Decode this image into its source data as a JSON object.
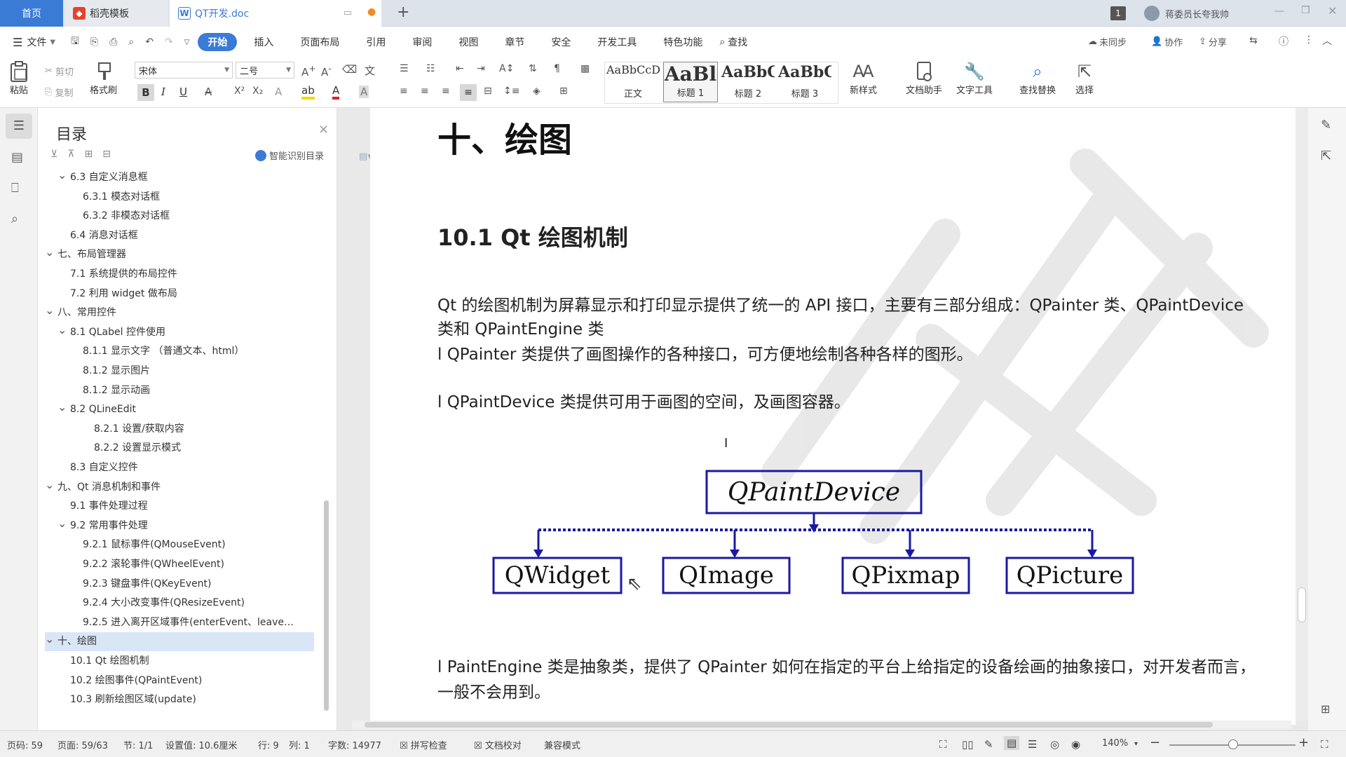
{
  "tabs": {
    "home": "首页",
    "template": "稻壳模板",
    "doc": "QT开发.doc",
    "add": "+"
  },
  "titlebar": {
    "badge": "1",
    "user": "蒋委员长夸我帅"
  },
  "menu": {
    "file": "文件",
    "items": [
      "开始",
      "插入",
      "页面布局",
      "引用",
      "审阅",
      "视图",
      "章节",
      "安全",
      "开发工具",
      "特色功能"
    ],
    "search": "查找",
    "sync": "未同步",
    "collab": "协作",
    "share": "分享"
  },
  "ribbon": {
    "paste": "粘贴",
    "cut": "剪切",
    "copy": "复制",
    "format_painter": "格式刷",
    "font_name": "宋体",
    "font_size": "二号",
    "styles": [
      {
        "preview": "AaBbCcDd",
        "name": "正文"
      },
      {
        "preview": "AaBl",
        "name": "标题 1"
      },
      {
        "preview": "AaBbC",
        "name": "标题 2"
      },
      {
        "preview": "AaBbC",
        "name": "标题 3"
      }
    ],
    "new_style": "新样式",
    "doc_helper": "文档助手",
    "text_tools": "文字工具",
    "find_replace": "查找替换",
    "select": "选择"
  },
  "toc": {
    "title": "目录",
    "smart": "智能识别目录",
    "items": [
      {
        "text": "6.3  自定义消息框",
        "level": 2,
        "caret": "v"
      },
      {
        "text": "6.3.1 模态对话框",
        "level": 3,
        "caret": ""
      },
      {
        "text": "6.3.2 非模态对话框",
        "level": 3,
        "caret": ""
      },
      {
        "text": "6.4  消息对话框",
        "level": 2,
        "caret": ""
      },
      {
        "text": "七、布局管理器",
        "level": 1,
        "caret": "v"
      },
      {
        "text": "7.1  系统提供的布局控件",
        "level": 2,
        "caret": ""
      },
      {
        "text": "7.2  利用 widget 做布局",
        "level": 2,
        "caret": ""
      },
      {
        "text": "八、常用控件",
        "level": 1,
        "caret": "v"
      },
      {
        "text": "8.1 QLabel 控件使用",
        "level": 2,
        "caret": "v"
      },
      {
        "text": "8.1.1 显示文字  （普通文本、html）",
        "level": 3,
        "caret": ""
      },
      {
        "text": "8.1.2 显示图片",
        "level": 3,
        "caret": ""
      },
      {
        "text": "8.1.2 显示动画",
        "level": 3,
        "caret": ""
      },
      {
        "text": "8.2 QLineEdit",
        "level": 2,
        "caret": "v"
      },
      {
        "text": "8.2.1 设置/获取内容",
        "level": 4,
        "caret": ""
      },
      {
        "text": "8.2.2 设置显示模式",
        "level": 4,
        "caret": ""
      },
      {
        "text": "8.3  自定义控件",
        "level": 2,
        "caret": ""
      },
      {
        "text": "九、Qt 消息机制和事件",
        "level": 1,
        "caret": "v"
      },
      {
        "text": "9.1  事件处理过程",
        "level": 2,
        "caret": ""
      },
      {
        "text": "9.2  常用事件处理",
        "level": 2,
        "caret": "v"
      },
      {
        "text": "9.2.1  鼠标事件(QMouseEvent)",
        "level": 3,
        "caret": ""
      },
      {
        "text": "9.2.2  滚轮事件(QWheelEvent)",
        "level": 3,
        "caret": ""
      },
      {
        "text": "9.2.3  键盘事件(QKeyEvent)",
        "level": 3,
        "caret": ""
      },
      {
        "text": "9.2.4  大小改变事件(QResizeEvent)",
        "level": 3,
        "caret": ""
      },
      {
        "text": "9.2.5  进入离开区域事件(enterEvent、leave…",
        "level": 3,
        "caret": ""
      },
      {
        "text": "十、绘图",
        "level": 1,
        "caret": "v",
        "selected": true
      },
      {
        "text": "10.1 Qt 绘图机制",
        "level": 2,
        "caret": ""
      },
      {
        "text": "10.2  绘图事件(QPaintEvent)",
        "level": 2,
        "caret": ""
      },
      {
        "text": "10.3  刷新绘图区域(update)",
        "level": 2,
        "caret": ""
      }
    ]
  },
  "doc": {
    "h1": "十、绘图",
    "h2": "10.1 Qt 绘图机制",
    "p1": "Qt 的绘图机制为屏幕显示和打印显示提供了统一的 API 接口，主要有三部分组成：QPainter 类、QPaintDevice",
    "p1b": "类和 QPaintEngine 类",
    "p2": "l QPainter 类提供了画图操作的各种接口，可方便地绘制各种各样的图形。",
    "p3": "l QPaintDevice 类提供可用于画图的空间，及画图容器。",
    "p4": "l PaintEngine 类是抽象类，提供了 QPainter 如何在指定的平台上给指定的设备绘画的抽象接口，对开发者而言，",
    "p4b": "一般不会用到。",
    "diagram": {
      "root": "QPaintDevice",
      "children": [
        "QWidget",
        "QImage",
        "QPixmap",
        "QPicture"
      ]
    }
  },
  "status": {
    "page_num": "页码: 59",
    "pages": "页面: 59/63",
    "section": "节: 1/1",
    "setting": "设置值: 10.6厘米",
    "row": "行: 9",
    "col": "列: 1",
    "words": "字数: 14977",
    "spell": "拼写检查",
    "proof": "文档校对",
    "compat": "兼容模式",
    "zoom": "140%"
  },
  "colors": {
    "accent": "#3a7bd5",
    "diagram_blue": "#1a1aa0"
  }
}
